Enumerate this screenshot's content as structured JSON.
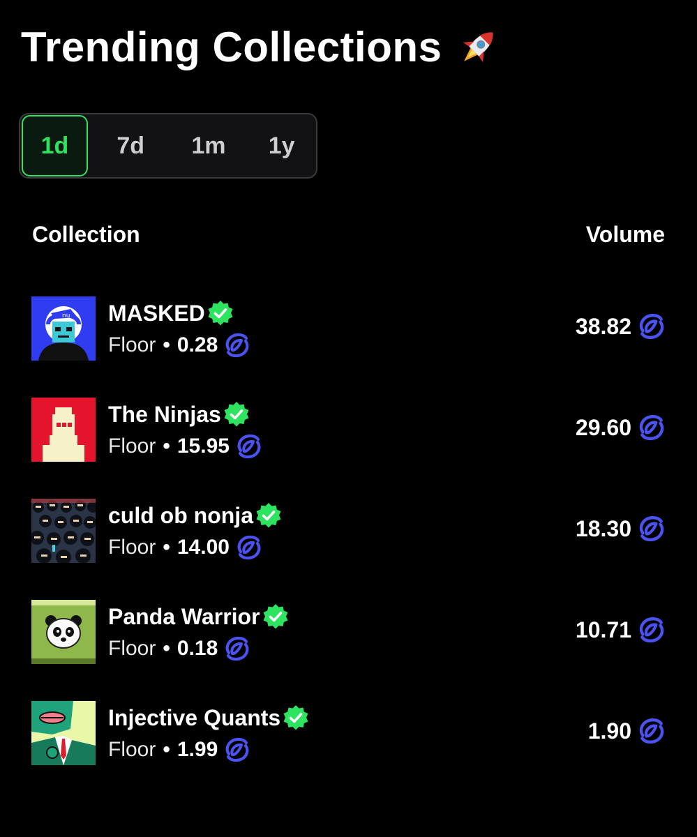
{
  "header": {
    "title": "Trending Collections"
  },
  "tabs": [
    {
      "label": "1d",
      "active": true
    },
    {
      "label": "7d",
      "active": false
    },
    {
      "label": "1m",
      "active": false
    },
    {
      "label": "1y",
      "active": false
    }
  ],
  "table": {
    "col_collection": "Collection",
    "col_volume": "Volume",
    "floor_label": "Floor",
    "separator": "•",
    "rows": [
      {
        "name": "MASKED",
        "floor": "0.28",
        "volume": "38.82",
        "verified": true
      },
      {
        "name": "The Ninjas",
        "floor": "15.95",
        "volume": "29.60",
        "verified": true
      },
      {
        "name": "culd ob nonja",
        "floor": "14.00",
        "volume": "18.30",
        "verified": true
      },
      {
        "name": "Panda Warrior",
        "floor": "0.18",
        "volume": "10.71",
        "verified": true
      },
      {
        "name": "Injective Quants",
        "floor": "1.99",
        "volume": "1.90",
        "verified": true
      }
    ]
  },
  "icons": {
    "rocket": "rocket-icon",
    "verified": "verified-badge-icon",
    "token": "injective-token-icon"
  },
  "colors": {
    "accent_green": "#2ee35f",
    "token_blue": "#4a52f0",
    "background": "#000000"
  }
}
